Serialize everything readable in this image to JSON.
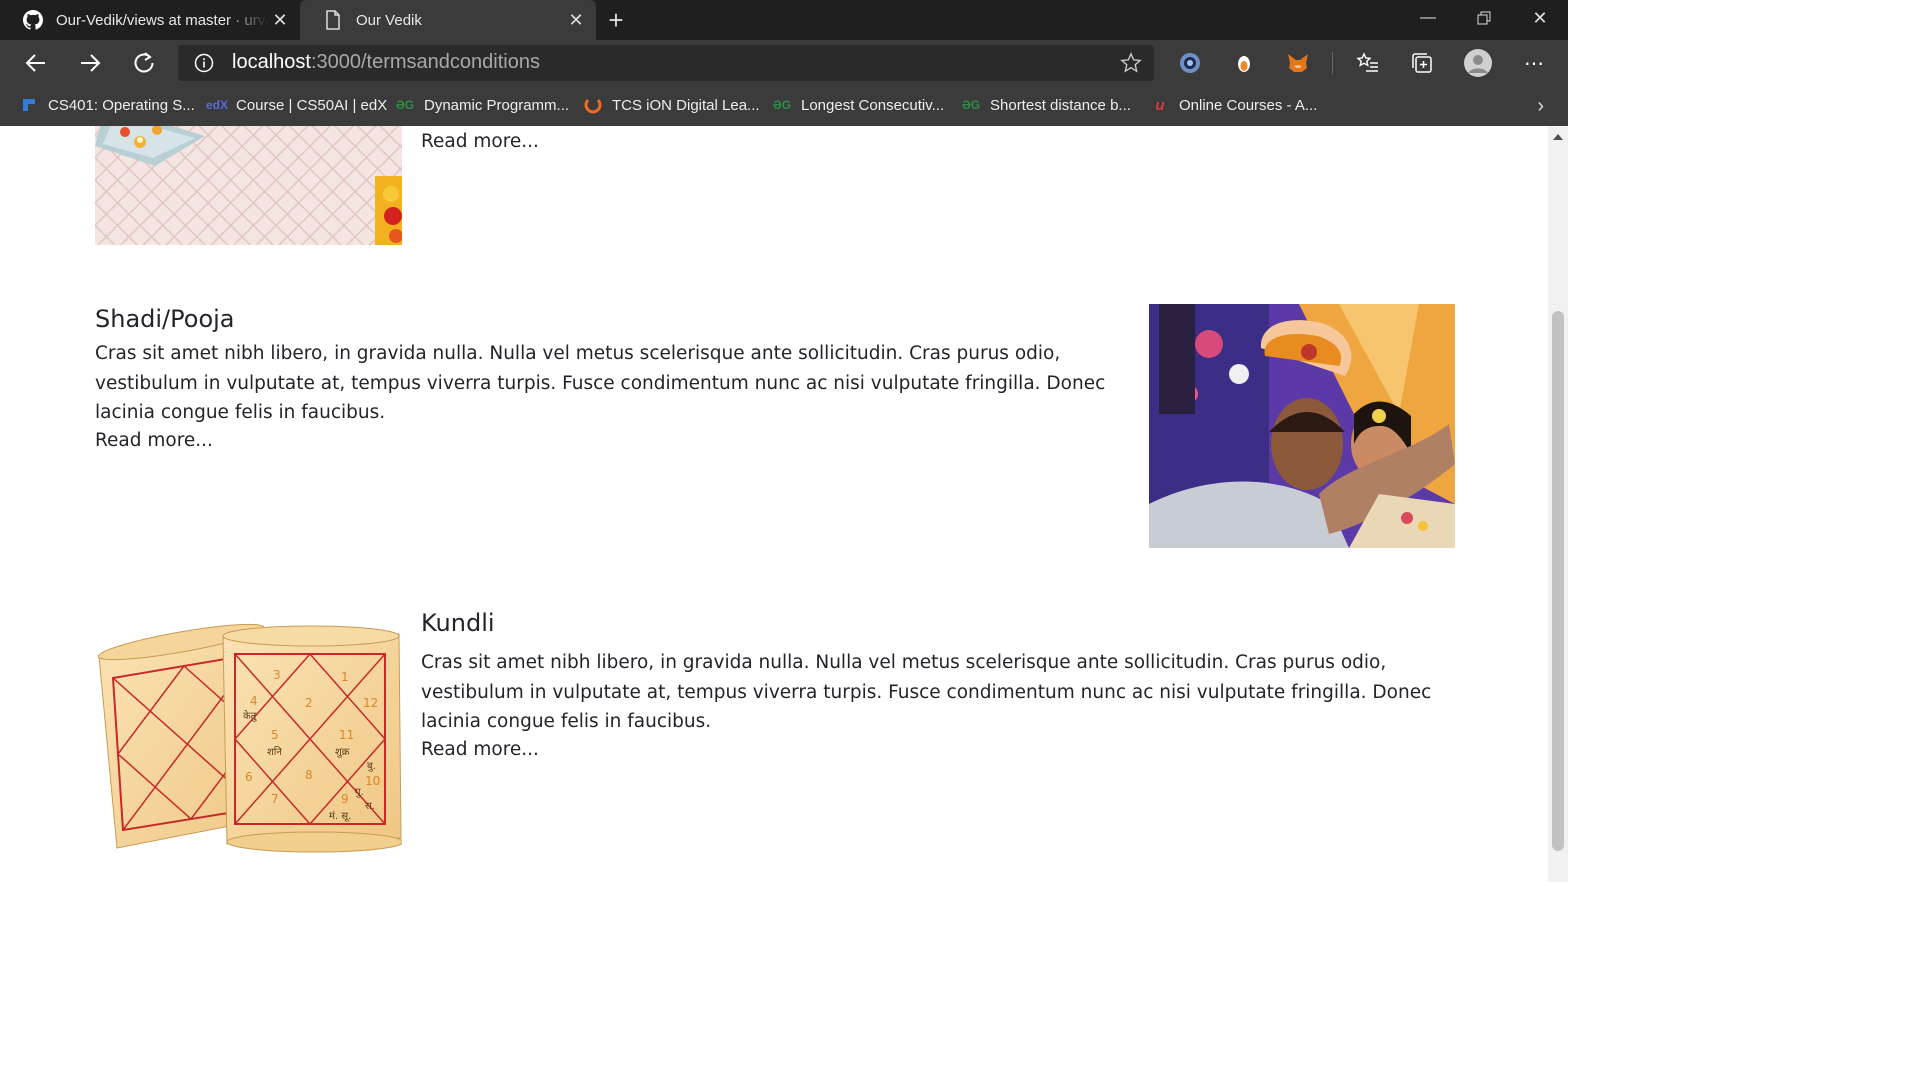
{
  "browser": {
    "tabs": [
      {
        "title": "Our-Vedik/views at master · urvashi"
      },
      {
        "title": "Our Vedik"
      }
    ],
    "url_host": "localhost",
    "url_rest": ":3000/termsandconditions",
    "bookmarks": [
      {
        "label": "CS401: Operating S..."
      },
      {
        "label": "Course | CS50AI | edX"
      },
      {
        "label": "Dynamic Programm..."
      },
      {
        "label": "TCS iON Digital Lea..."
      },
      {
        "label": "Longest Consecutiv..."
      },
      {
        "label": "Shortest distance b..."
      },
      {
        "label": "Online Courses - A..."
      }
    ]
  },
  "content": {
    "sections": [
      {
        "read_more": "Read more..."
      },
      {
        "title": "Shadi/Pooja",
        "body": "Cras sit amet nibh libero, in gravida nulla. Nulla vel metus scelerisque ante sollicitudin. Cras purus odio, vestibulum in vulputate at, tempus viverra turpis. Fusce condimentum nunc ac nisi vulputate fringilla. Donec lacinia congue felis in faucibus.",
        "read_more": "Read more..."
      },
      {
        "title": "Kundli",
        "body": "Cras sit amet nibh libero, in gravida nulla. Nulla vel metus scelerisque ante sollicitudin. Cras purus odio, vestibulum in vulputate at, tempus viverra turpis. Fusce condimentum nunc ac nisi vulputate fringilla. Donec lacinia congue felis in faucibus.",
        "read_more": "Read more..."
      }
    ],
    "kundli_numbers": [
      "3",
      "2",
      "1",
      "4",
      "12",
      "5",
      "11",
      "6",
      "8",
      "7",
      "9",
      "10"
    ],
    "kundli_glyphs": [
      "केतु",
      "शनि",
      "शुक्र",
      "बु.",
      "गु.",
      "रा.",
      "मं. सू."
    ]
  }
}
